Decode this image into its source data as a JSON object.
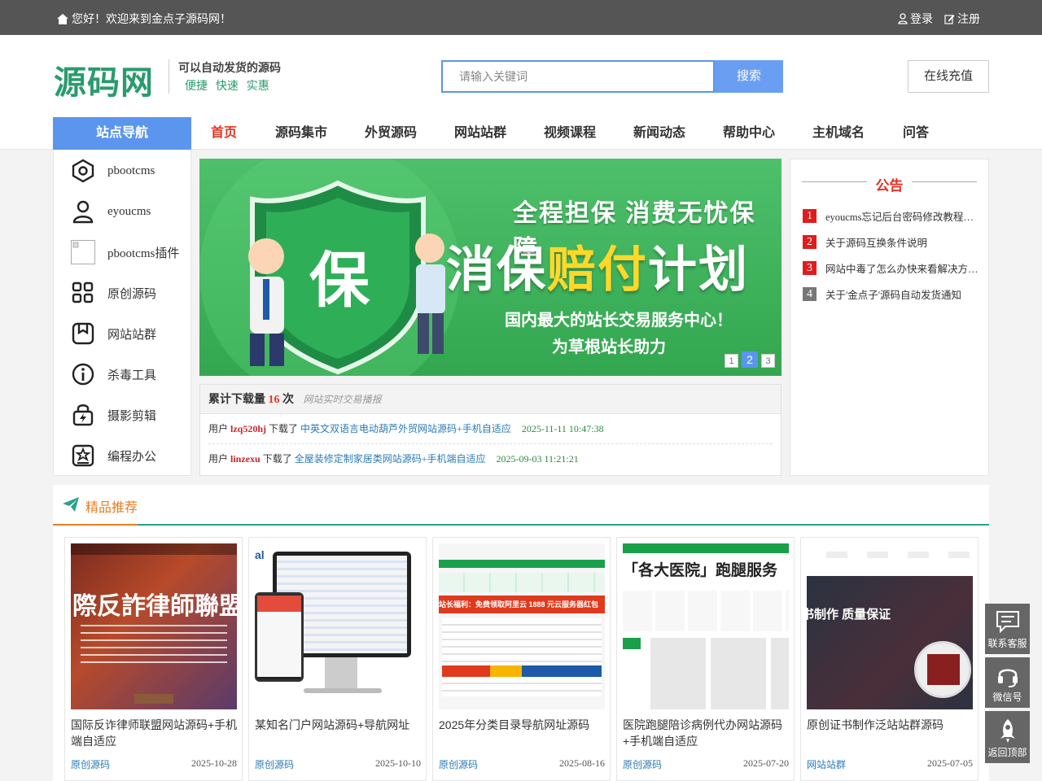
{
  "topbar": {
    "welcome": "您好！欢迎来到金点子源码网！",
    "login": "登录",
    "register": "注册"
  },
  "header": {
    "logo": "源码网",
    "slogan_line1": "可以自动发货的源码",
    "slogan_line2": "便捷 快速 实惠",
    "search_placeholder": "请输入关键词",
    "search_button": "搜索",
    "recharge": "在线充值"
  },
  "nav": {
    "side_title": "站点导航",
    "items": [
      {
        "label": "首页",
        "active": true
      },
      {
        "label": "源码集市"
      },
      {
        "label": "外贸源码"
      },
      {
        "label": "网站站群"
      },
      {
        "label": "视频课程"
      },
      {
        "label": "新闻动态"
      },
      {
        "label": "帮助中心"
      },
      {
        "label": "主机域名"
      },
      {
        "label": "问答"
      }
    ]
  },
  "categories": [
    {
      "label": "pbootcms",
      "icon": "hexagon-icon"
    },
    {
      "label": "eyoucms",
      "icon": "user-icon"
    },
    {
      "label": "pbootcms插件",
      "icon": "broken-image-icon"
    },
    {
      "label": "原创源码",
      "icon": "grid-icon"
    },
    {
      "label": "网站站群",
      "icon": "bookmark-icon"
    },
    {
      "label": "杀毒工具",
      "icon": "info-icon"
    },
    {
      "label": "摄影剪辑",
      "icon": "lock-bolt-icon"
    },
    {
      "label": "编程办公",
      "icon": "badge-icon"
    }
  ],
  "banner": {
    "headline1": "全程担保 消费无忧保障",
    "headline2_a": "消保",
    "headline2_b": "赔付",
    "headline2_c": "计划",
    "shield_char": "保",
    "line3": "国内最大的站长交易服务中心！",
    "line4": "为草根站长助力",
    "pages": [
      "1",
      "2",
      "3"
    ],
    "current_page": "2"
  },
  "downloads": {
    "label": "累计下载量",
    "count": "16",
    "unit": "次",
    "subtitle": "网站实时交易播报",
    "rows": [
      {
        "prefix": "用户",
        "user": "lzq520hj",
        "action": "下载了",
        "product": "中英文双语言电动葫芦外贸网站源码+手机自适应",
        "time": "2025-11-11 10:47:38"
      },
      {
        "prefix": "用户",
        "user": "linzexu",
        "action": "下载了",
        "product": "全屋装修定制家居类网站源码+手机端自适应",
        "time": "2025-09-03 11:21:21"
      }
    ]
  },
  "notice": {
    "title": "公告",
    "items": [
      {
        "num": "1",
        "text": "eyoucms忘记后台密码修改教程…",
        "color": "#e01d1d"
      },
      {
        "num": "2",
        "text": "关于源码互换条件说明",
        "color": "#e01d1d"
      },
      {
        "num": "3",
        "text": "网站中毒了怎么办快来看解决方…",
        "color": "#e01d1d"
      },
      {
        "num": "4",
        "text": "关于'金点子'源码自动发货通知",
        "color": "#777777"
      }
    ]
  },
  "recommend": {
    "title": "精品推荐",
    "cards": [
      {
        "title": "国际反诈律师联盟网站源码+手机端自适应",
        "category": "原创源码",
        "date": "2025-10-28",
        "img_text": "際反詐律師聯盟"
      },
      {
        "title": "某知名门户网站源码+导航网址",
        "category": "原创源码",
        "date": "2025-10-10",
        "img_text": "al"
      },
      {
        "title": "2025年分类目录导航网址源码",
        "category": "原创源码",
        "date": "2025-08-16",
        "img_text": "站长福利：免费领取阿里云 1888 元云服务器红包"
      },
      {
        "title": "医院跑腿陪诊病例代办网站源码+手机端自适应",
        "category": "原创源码",
        "date": "2025-07-20",
        "img_text": "「各大医院」跑腿服务"
      },
      {
        "title": "原创证书制作泛站站群源码",
        "category": "网站站群",
        "date": "2025-07-05",
        "img_text": "书制作 质量保证"
      }
    ]
  },
  "float": {
    "service": "联系客服",
    "wechat": "微信号",
    "top": "返回顶部"
  },
  "colors": {
    "accent_blue": "#5b95ee",
    "red": "#e6311f",
    "green": "#2a9b6e",
    "teal": "#2ba28a"
  }
}
